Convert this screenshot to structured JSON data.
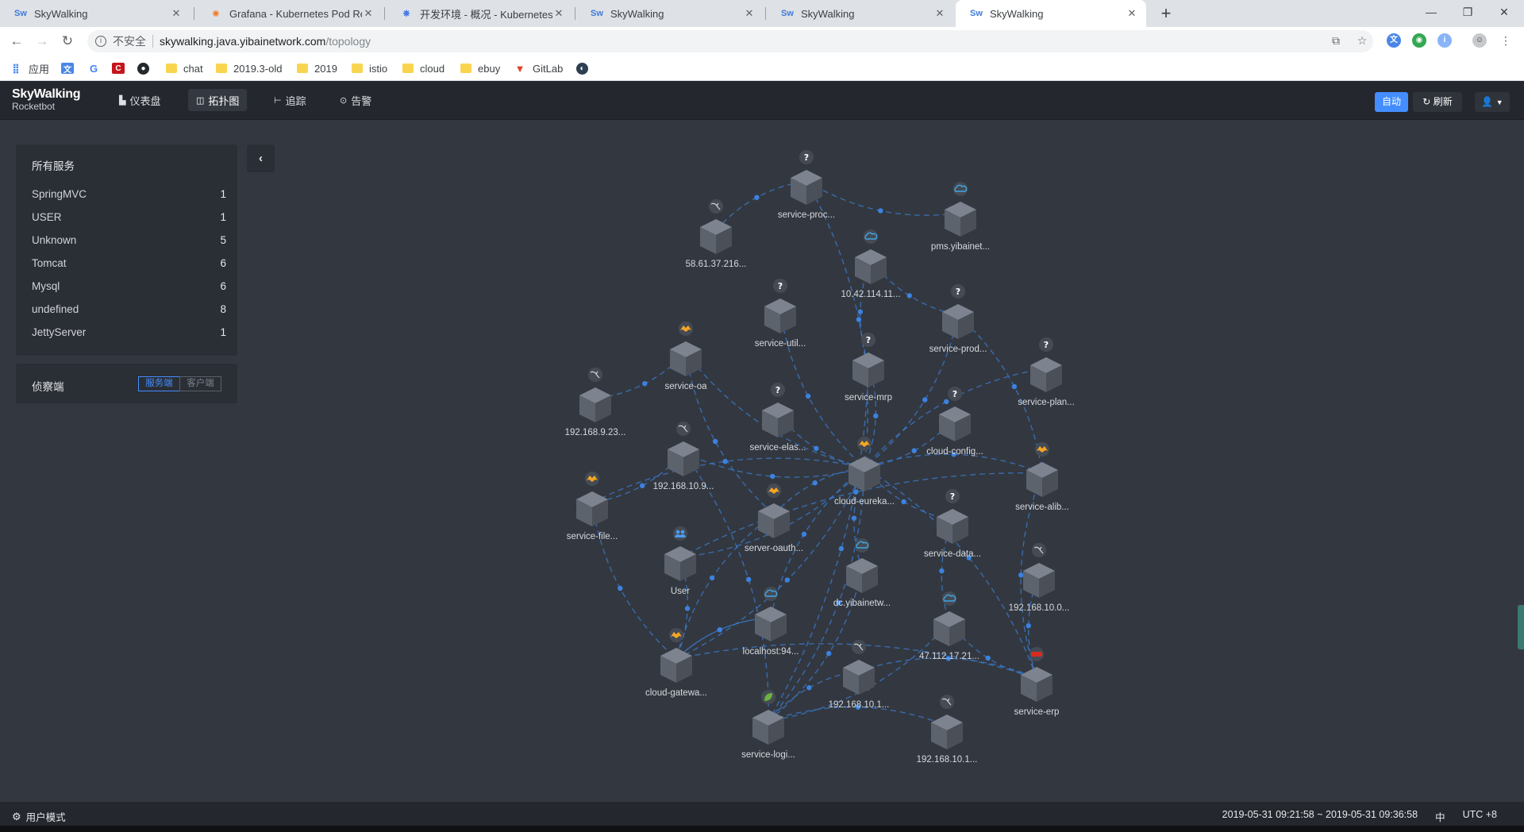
{
  "browser": {
    "tabs": [
      {
        "title": "SkyWalking",
        "icon": "skywalking-favicon",
        "active": false
      },
      {
        "title": "Grafana - Kubernetes Pod Resources",
        "icon": "grafana-favicon",
        "active": false
      },
      {
        "title": "开发环境 - 概况 - Kubernetes Dashboard",
        "icon": "kubernetes-favicon",
        "active": false
      },
      {
        "title": "SkyWalking",
        "icon": "skywalking-favicon",
        "active": false
      },
      {
        "title": "SkyWalking",
        "icon": "skywalking-favicon",
        "active": false
      },
      {
        "title": "SkyWalking",
        "icon": "skywalking-favicon",
        "active": true
      }
    ],
    "address": {
      "security_label": "不安全",
      "host": "skywalking.java.yibainetwork.com",
      "path": "/topology"
    },
    "bookmarks": [
      {
        "label": "应用",
        "icon": "apps-grid-icon"
      },
      {
        "label": "",
        "icon": "translate-icon"
      },
      {
        "label": "",
        "icon": "google-icon"
      },
      {
        "label": "",
        "icon": "c-logo-icon"
      },
      {
        "label": "",
        "icon": "github-icon"
      },
      {
        "label": "chat",
        "icon": "folder-icon"
      },
      {
        "label": "2019.3-old",
        "icon": "folder-icon"
      },
      {
        "label": "2019",
        "icon": "folder-icon"
      },
      {
        "label": "istio",
        "icon": "folder-icon"
      },
      {
        "label": "cloud",
        "icon": "folder-icon"
      },
      {
        "label": "ebuy",
        "icon": "folder-icon"
      },
      {
        "label": "GitLab",
        "icon": "gitlab-icon"
      },
      {
        "label": "",
        "icon": "docker-icon"
      }
    ]
  },
  "app": {
    "logo_line1": "SkyWalking",
    "logo_line2": "Rocketbot",
    "nav": [
      {
        "label": "仪表盘",
        "icon": "dashboard-icon"
      },
      {
        "label": "拓扑图",
        "icon": "topology-icon",
        "active": true
      },
      {
        "label": "追踪",
        "icon": "trace-icon"
      },
      {
        "label": "告警",
        "icon": "alarm-icon"
      }
    ],
    "auto_label": "自动",
    "refresh_label": "刷新",
    "accent_color": "#448dfe"
  },
  "sidebar": {
    "title": "所有服务",
    "services": [
      {
        "name": "SpringMVC",
        "count": "1"
      },
      {
        "name": "USER",
        "count": "1"
      },
      {
        "name": "Unknown",
        "count": "5"
      },
      {
        "name": "Tomcat",
        "count": "6"
      },
      {
        "name": "Mysql",
        "count": "6"
      },
      {
        "name": "undefined",
        "count": "8"
      },
      {
        "name": "JettyServer",
        "count": "1"
      }
    ],
    "observer_label": "侦察端",
    "observer_server": "服务端",
    "observer_client": "客户端"
  },
  "topology": {
    "nodes": [
      {
        "id": "proc",
        "label": "service-proc...",
        "type": "unknown"
      },
      {
        "id": "pms",
        "label": "pms.yibainet...",
        "type": "cloud"
      },
      {
        "id": "ip58",
        "label": "58.61.37.216...",
        "type": "mysql"
      },
      {
        "id": "ip1042",
        "label": "10.42.114.11...",
        "type": "cloud"
      },
      {
        "id": "util",
        "label": "service-util...",
        "type": "unknown"
      },
      {
        "id": "prod",
        "label": "service-prod...",
        "type": "unknown"
      },
      {
        "id": "oa",
        "label": "service-oa",
        "type": "tomcat"
      },
      {
        "id": "mrp",
        "label": "service-mrp",
        "type": "unknown"
      },
      {
        "id": "plan",
        "label": "service-plan...",
        "type": "unknown"
      },
      {
        "id": "ip19209",
        "label": "192.168.9.23...",
        "type": "mysql"
      },
      {
        "id": "elas",
        "label": "service-elas...",
        "type": "unknown"
      },
      {
        "id": "cloudconfig",
        "label": "cloud-config...",
        "type": "unknown"
      },
      {
        "id": "ip19210a",
        "label": "192.168.10.9...",
        "type": "mysql"
      },
      {
        "id": "eureka",
        "label": "cloud-eureka...",
        "type": "tomcat"
      },
      {
        "id": "alib",
        "label": "service-alib...",
        "type": "tomcat"
      },
      {
        "id": "file",
        "label": "service-file...",
        "type": "tomcat"
      },
      {
        "id": "oauth",
        "label": "server-oauth...",
        "type": "tomcat"
      },
      {
        "id": "data",
        "label": "service-data...",
        "type": "unknown"
      },
      {
        "id": "user",
        "label": "User",
        "type": "user"
      },
      {
        "id": "dc",
        "label": "dc.yibainetw...",
        "type": "cloud"
      },
      {
        "id": "ip19210b",
        "label": "192.168.10.0...",
        "type": "mysql"
      },
      {
        "id": "localhost",
        "label": "localhost:94...",
        "type": "cloud"
      },
      {
        "id": "ip47",
        "label": "47.112.17.21...",
        "type": "cloud"
      },
      {
        "id": "gateway",
        "label": "cloud-gatewa...",
        "type": "tomcat"
      },
      {
        "id": "ip19210c",
        "label": "192.168.10.1...",
        "type": "mysql"
      },
      {
        "id": "erp",
        "label": "service-erp",
        "type": "redis"
      },
      {
        "id": "logi",
        "label": "service-logi...",
        "type": "spring"
      },
      {
        "id": "ip19210d",
        "label": "192.168.10.1...",
        "type": "mysql"
      }
    ],
    "edges": [
      [
        "ip58",
        "proc"
      ],
      [
        "proc",
        "pms"
      ],
      [
        "proc",
        "eureka"
      ],
      [
        "ip1042",
        "prod"
      ],
      [
        "mrp",
        "ip1042"
      ],
      [
        "util",
        "eureka"
      ],
      [
        "prod",
        "eureka"
      ],
      [
        "oa",
        "eureka"
      ],
      [
        "oa",
        "ip19209"
      ],
      [
        "oa",
        "oauth"
      ],
      [
        "mrp",
        "eureka"
      ],
      [
        "plan",
        "eureka"
      ],
      [
        "prod",
        "alib"
      ],
      [
        "elas",
        "eureka"
      ],
      [
        "cloudconfig",
        "eureka"
      ],
      [
        "ip19210a",
        "eureka"
      ],
      [
        "ip19210a",
        "file"
      ],
      [
        "alib",
        "eureka"
      ],
      [
        "file",
        "eureka"
      ],
      [
        "file",
        "gateway"
      ],
      [
        "oauth",
        "eureka"
      ],
      [
        "oauth",
        "gateway"
      ],
      [
        "data",
        "eureka"
      ],
      [
        "data",
        "ip47"
      ],
      [
        "user",
        "gateway"
      ],
      [
        "user",
        "eureka"
      ],
      [
        "dc",
        "eureka"
      ],
      [
        "ip19210b",
        "erp"
      ],
      [
        "localhost",
        "eureka"
      ],
      [
        "localhost",
        "gateway"
      ],
      [
        "ip47",
        "logi"
      ],
      [
        "ip47",
        "erp"
      ],
      [
        "gateway",
        "erp"
      ],
      [
        "gateway",
        "eureka"
      ],
      [
        "gateway",
        "localhost"
      ],
      [
        "ip19210c",
        "logi"
      ],
      [
        "ip19210c",
        "erp"
      ],
      [
        "erp",
        "eureka"
      ],
      [
        "erp",
        "alib"
      ],
      [
        "logi",
        "eureka"
      ],
      [
        "logi",
        "ip19210d"
      ],
      [
        "logi",
        "dc"
      ],
      [
        "mrp",
        "logi"
      ],
      [
        "alib",
        "user"
      ],
      [
        "ip19210a",
        "logi"
      ]
    ]
  },
  "footer": {
    "mode_label": "用户模式",
    "time_range": "2019-05-31 09:21:58 ~ 2019-05-31 09:36:58",
    "lang": "中",
    "timezone": "UTC +8"
  }
}
